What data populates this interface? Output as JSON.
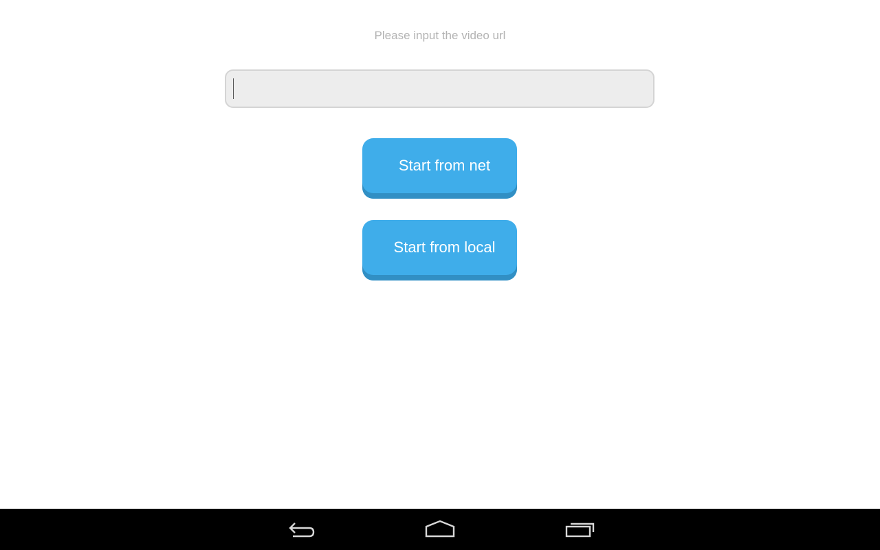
{
  "main": {
    "prompt_label": "Please input the video url",
    "url_input": {
      "value": "",
      "placeholder": ""
    },
    "buttons": {
      "start_net_label": "Start from net",
      "start_local_label": "Start from local"
    }
  },
  "nav_bar": {
    "items": [
      {
        "icon": "back-icon"
      },
      {
        "icon": "home-icon"
      },
      {
        "icon": "recent-apps-icon"
      }
    ]
  },
  "colors": {
    "button_fill": "#3fadea",
    "button_shadow": "#318fc4",
    "input_fill": "#ededed",
    "nav_bar": "#000000",
    "prompt_text": "#b3b3b3"
  }
}
